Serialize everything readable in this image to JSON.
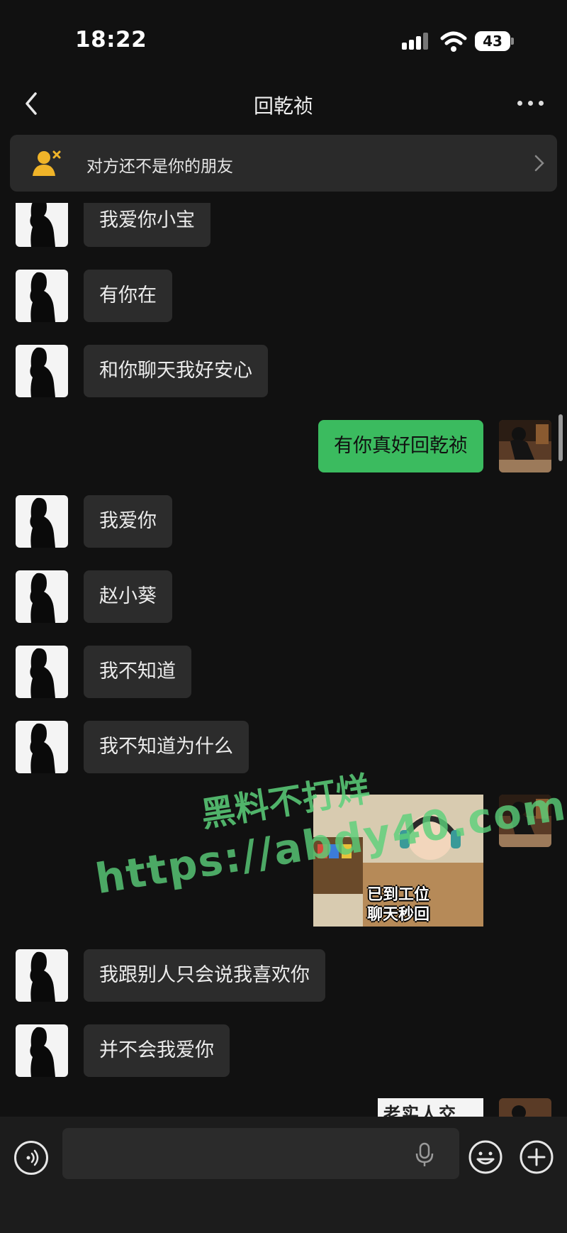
{
  "status": {
    "time": "18:22",
    "battery": "43"
  },
  "nav": {
    "title": "回乾祯"
  },
  "banner": {
    "text": "对方还不是你的朋友"
  },
  "messages": [
    {
      "side": "left",
      "text": "我爱你小宝"
    },
    {
      "side": "left",
      "text": "有你在"
    },
    {
      "side": "left",
      "text": "和你聊天我好安心"
    },
    {
      "side": "right",
      "text": "有你真好回乾祯"
    },
    {
      "side": "left",
      "text": "我爱你"
    },
    {
      "side": "left",
      "text": "赵小葵"
    },
    {
      "side": "left",
      "text": "我不知道"
    },
    {
      "side": "left",
      "text": "我不知道为什么"
    },
    {
      "side": "right",
      "sticker_text": [
        "已到工位",
        "聊天秒回"
      ]
    },
    {
      "side": "left",
      "text": "我跟别人只会说我喜欢你"
    },
    {
      "side": "left",
      "text": "并不会我爱你"
    },
    {
      "side": "right",
      "sticker_text_partial": "老实人交"
    }
  ],
  "watermark": {
    "line1": "黑料不打烊",
    "line2": "https://abdy40.com"
  },
  "input": {
    "placeholder": ""
  },
  "colors": {
    "background": "#111111",
    "bubble_left": "#2c2c2c",
    "bubble_right": "#3bbb5f",
    "banner_icon": "#f0b429"
  }
}
